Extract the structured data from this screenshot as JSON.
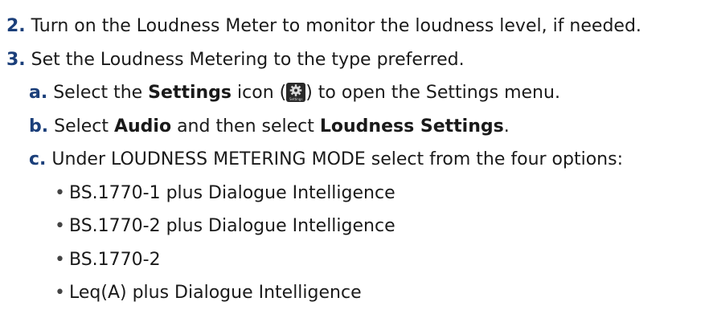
{
  "steps": [
    {
      "number": "2.",
      "text": "Turn on the Loudness Meter to monitor the loudness level, if needed."
    },
    {
      "number": "3.",
      "text": "Set the Loudness Metering to the type preferred."
    }
  ],
  "substeps": {
    "a": {
      "letter": "a.",
      "pre": "Select the",
      "bold": "Settings",
      "mid": "icon (",
      "icon_caption": "Settings",
      "post": ") to open the Settings menu."
    },
    "b": {
      "letter": "b.",
      "pre": "Select",
      "bold1": "Audio",
      "mid": "and then select",
      "bold2": "Loudness Settings",
      "post": "."
    },
    "c": {
      "letter": "c.",
      "text": "Under LOUDNESS METERING MODE select from the four options:"
    }
  },
  "options": [
    "BS.1770-1 plus Dialogue Intelligence",
    "BS.1770-2 plus Dialogue Intelligence",
    "BS.1770-2",
    "Leq(A) plus Dialogue Intelligence"
  ],
  "bullet_char": "•",
  "colors": {
    "accent": "#1b3f7a",
    "text": "#1a1a1a"
  }
}
